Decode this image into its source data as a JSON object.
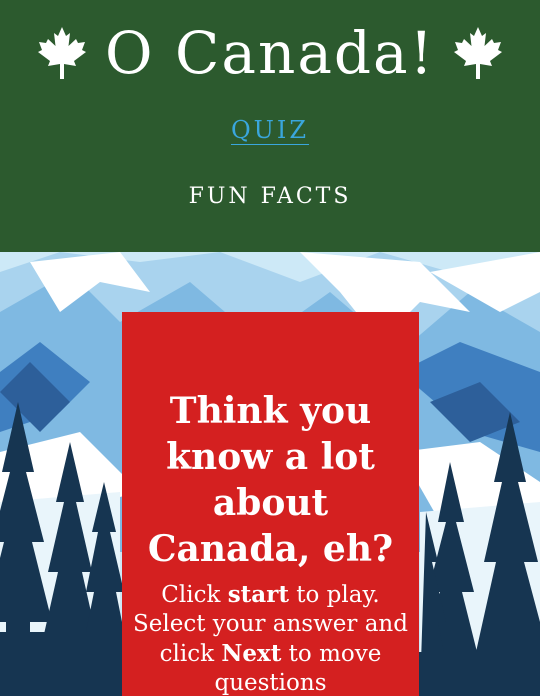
{
  "header": {
    "title": "O Canada!",
    "leaf_icon": "maple-leaf-icon",
    "bg_color": "#2c5a2e"
  },
  "nav": {
    "quiz_label": "QUIZ",
    "facts_label": "FUN FACTS",
    "active_color": "#3aa6dd"
  },
  "hero": {
    "background": "mountain-forest-illustration"
  },
  "intro": {
    "heading": "Think you know a lot about Canada, eh?",
    "text_1": "Click ",
    "start_word": "start",
    "text_2": " to play. Select your answer and click ",
    "next_word": "Next",
    "text_3": " to move questions",
    "card_color": "#d42020"
  }
}
